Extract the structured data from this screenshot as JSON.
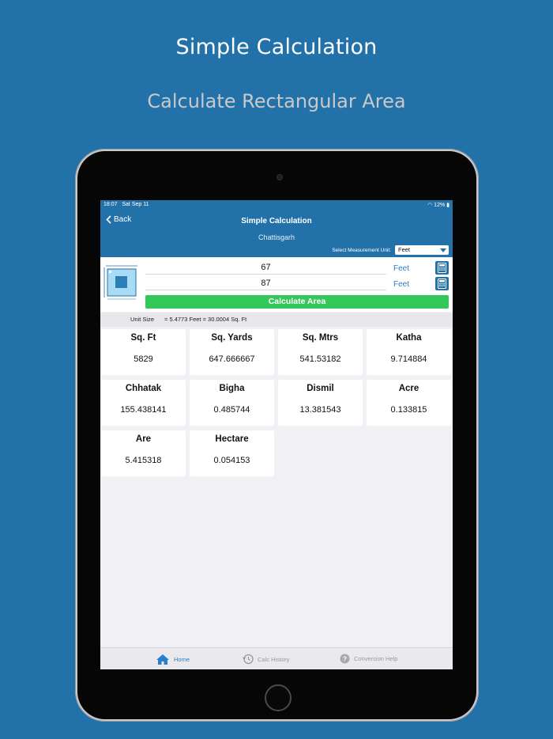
{
  "promo": {
    "title": "Simple Calculation",
    "subtitle": "Calculate Rectangular Area"
  },
  "status_bar": {
    "time": "18:07",
    "date": "Sat Sep 11",
    "battery": "12%"
  },
  "nav": {
    "back_label": "Back",
    "title": "Simple Calculation",
    "subtitle": "Chattisgarh"
  },
  "unit_selector": {
    "label": "Select Measurement Unit:",
    "selected": "Feet"
  },
  "inputs": {
    "length": {
      "value": "67",
      "unit": "Feet"
    },
    "width": {
      "value": "87",
      "unit": "Feet"
    }
  },
  "calculate_button": "Calculate Area",
  "unit_size": {
    "label": "Unit Size",
    "value": "= 5.4773 Feet = 30.0004 Sq. Ft"
  },
  "results": [
    {
      "title": "Sq. Ft",
      "value": "5829"
    },
    {
      "title": "Sq. Yards",
      "value": "647.666667"
    },
    {
      "title": "Sq. Mtrs",
      "value": "541.53182"
    },
    {
      "title": "Katha",
      "value": "9.714884"
    },
    {
      "title": "Chhatak",
      "value": "155.438141"
    },
    {
      "title": "Bigha",
      "value": "0.485744"
    },
    {
      "title": "Dismil",
      "value": "13.381543"
    },
    {
      "title": "Acre",
      "value": "0.133815"
    },
    {
      "title": "Are",
      "value": "5.415318"
    },
    {
      "title": "Hectare",
      "value": "0.054153"
    }
  ],
  "tabs": [
    {
      "label": "Home",
      "icon": "home-icon",
      "active": true
    },
    {
      "label": "Calc History",
      "icon": "history-icon",
      "active": false
    },
    {
      "label": "Conversion Help",
      "icon": "help-icon",
      "active": false
    }
  ],
  "colors": {
    "background": "#2272a9",
    "accent": "#2d7ec6",
    "calculate": "#34c759"
  }
}
